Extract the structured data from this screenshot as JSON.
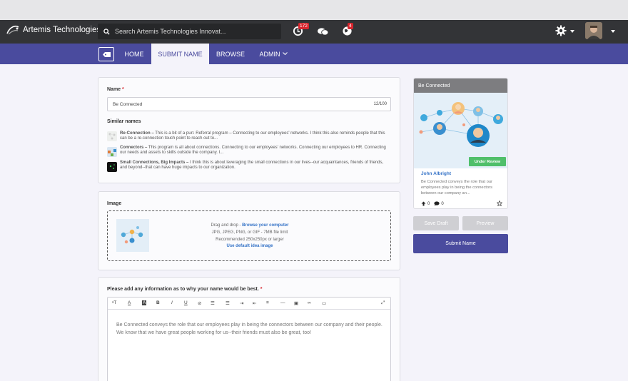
{
  "app": {
    "company": "Artemis Technologies",
    "search_placeholder": "Search Artemis Technologies Innovat...",
    "notifications_count": "172",
    "alerts_count": "4"
  },
  "nav": {
    "tabs": [
      "HOME",
      "SUBMIT NAME",
      "BROWSE",
      "ADMIN"
    ],
    "active": "SUBMIT NAME"
  },
  "name_section": {
    "label": "Name",
    "required_mark": "*",
    "value": "Be Connected",
    "counter": "12/100",
    "similar_label": "Similar names",
    "similar": [
      {
        "title": "Re-Connection –",
        "text": "This is a bit of a pun: Referral program – Connecting to our employees' networks. I think this also reminds people that this can be a re-connection touch point to reach out to..."
      },
      {
        "title": "Connectors –",
        "text": "This program is all about connections. Connecting to our employees' networks. Connecting our employees to HR. Connecting our needs and assets to skills outside the company. I..."
      },
      {
        "title": "Small Connections, Big Impacts –",
        "text": "I think this is about leveraging the small connections in our lives--our acquaintances, friends of friends, and beyond--that can have huge impacts to our organization."
      }
    ]
  },
  "image_section": {
    "label": "Image",
    "drag_text": "Drag and drop - ",
    "browse_link": "Browse your computer",
    "formats": "JPG, JPEG, PNG, or GIF - 7MB file limit",
    "recommended": "Recommended 250x250px or larger",
    "default_link": "Use default idea image"
  },
  "info_section": {
    "label": "Please add any information as to why your name would be best.",
    "required_mark": "*",
    "text": "Be Connected conveys the role that our employees play in being the connectors between our company and their people. We know that we have great people working for us--their friends must also be great, too!"
  },
  "preview_card": {
    "title": "Be Connected",
    "status": "Under Review",
    "author": "John Albright",
    "description": "Be Connected conveys the role that our employees play in being the connectors between our company an...",
    "upvotes": "0",
    "comments": "0"
  },
  "buttons": {
    "save_draft": "Save Draft",
    "preview": "Preview",
    "submit": "Submit Name"
  },
  "colors": {
    "nav_purple": "#4a4b9e",
    "topbar": "#333437",
    "badge_red": "#d7262e",
    "status_green": "#4fbf6a",
    "link_blue": "#3573c7"
  }
}
